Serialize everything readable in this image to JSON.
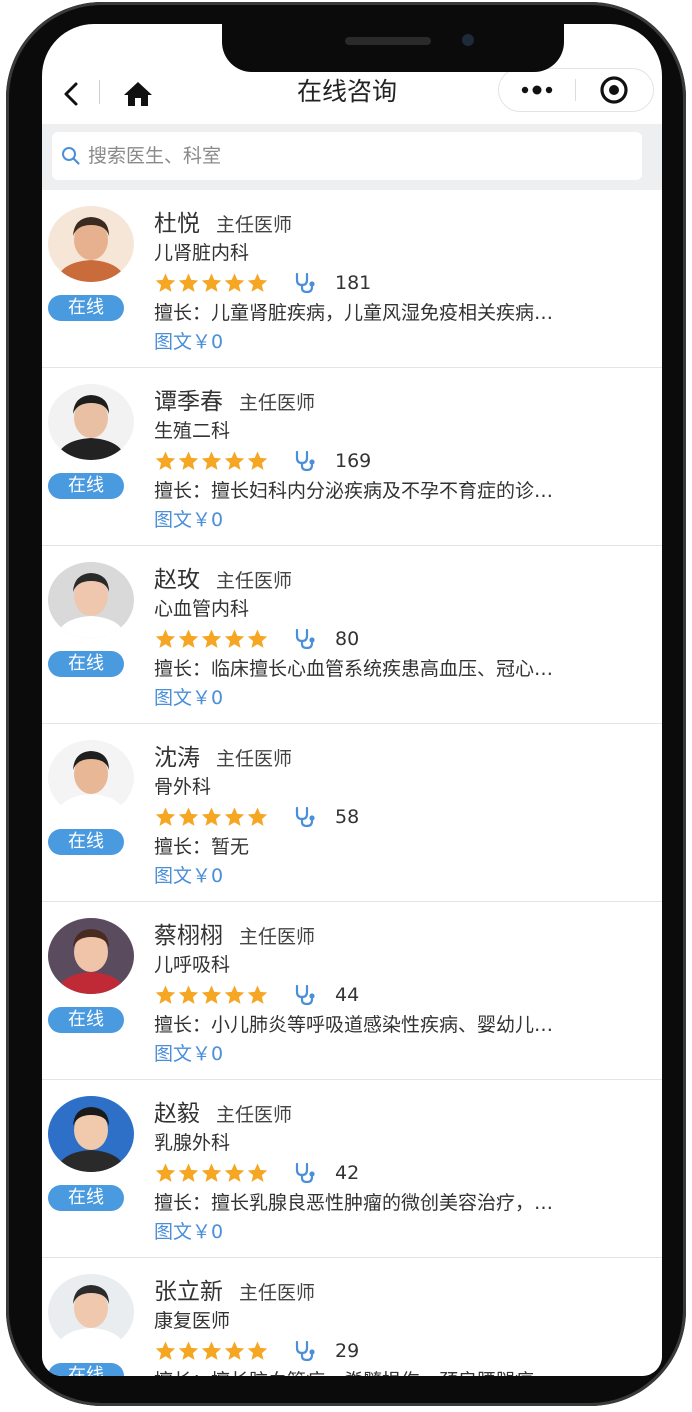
{
  "header": {
    "title": "在线咨询"
  },
  "search": {
    "placeholder": "搜索医生、科室"
  },
  "doctors": [
    {
      "name": "杜悦",
      "title": "主任医师",
      "department": "儿肾脏内科",
      "rating_stars": 5,
      "consult_count": "181",
      "specialty": "擅长：儿童肾脏疾病，儿童风湿免疫相关疾病…",
      "price": "图文￥0",
      "status": "在线"
    },
    {
      "name": "谭季春",
      "title": "主任医师",
      "department": "生殖二科",
      "rating_stars": 5,
      "consult_count": "169",
      "specialty": "擅长：擅长妇科内分泌疾病及不孕不育症的诊…",
      "price": "图文￥0",
      "status": "在线"
    },
    {
      "name": "赵玫",
      "title": "主任医师",
      "department": "心血管内科",
      "rating_stars": 5,
      "consult_count": "80",
      "specialty": "擅长：临床擅长心血管系统疾患高血压、冠心…",
      "price": "图文￥0",
      "status": "在线"
    },
    {
      "name": "沈涛",
      "title": "主任医师",
      "department": "骨外科",
      "rating_stars": 5,
      "consult_count": "58",
      "specialty": "擅长：暂无",
      "price": "图文￥0",
      "status": "在线"
    },
    {
      "name": "蔡栩栩",
      "title": "主任医师",
      "department": "儿呼吸科",
      "rating_stars": 5,
      "consult_count": "44",
      "specialty": "擅长：小儿肺炎等呼吸道感染性疾病、婴幼儿…",
      "price": "图文￥0",
      "status": "在线"
    },
    {
      "name": "赵毅",
      "title": "主任医师",
      "department": "乳腺外科",
      "rating_stars": 5,
      "consult_count": "42",
      "specialty": "擅长：擅长乳腺良恶性肿瘤的微创美容治疗，…",
      "price": "图文￥0",
      "status": "在线"
    },
    {
      "name": "张立新",
      "title": "主任医师",
      "department": "康复医师",
      "rating_stars": 5,
      "consult_count": "29",
      "specialty": "擅长：擅长脑血管病、脊髓损伤、颈肩腰腿痛…",
      "price": "",
      "status": "在线"
    }
  ],
  "colors": {
    "accent": "#4a9ae0",
    "price": "#4a8fd8",
    "star": "#f5a623",
    "search_bg": "#eeeff1"
  },
  "icons": {
    "back": "chevron-left-icon",
    "home": "home-icon",
    "more": "more-dots-icon",
    "close": "target-close-icon",
    "search": "search-icon",
    "star": "star-icon",
    "consult": "stethoscope-icon"
  }
}
